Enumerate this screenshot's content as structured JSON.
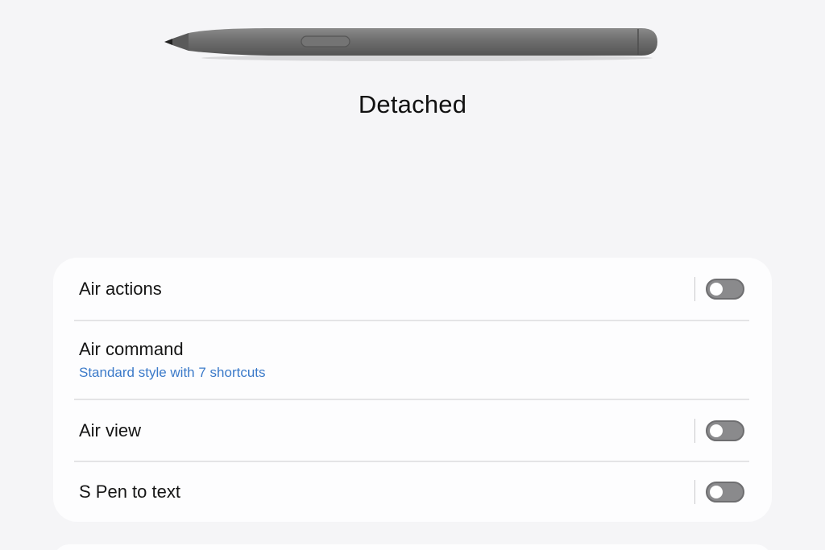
{
  "status": {
    "title": "Detached"
  },
  "settings": {
    "items": [
      {
        "label": "Air actions",
        "toggle_on": false
      },
      {
        "label": "Air command",
        "sub": "Standard style with 7 shortcuts"
      },
      {
        "label": "Air view",
        "toggle_on": false
      },
      {
        "label": "S Pen to text",
        "toggle_on": false
      }
    ]
  },
  "colors": {
    "background": "#f5f5f7",
    "card": "#fdfdfe",
    "accent": "#3b7ac9",
    "toggle_off": "#8a8a8c",
    "pen": "#6b6b6b"
  },
  "icons": {
    "pen": "s-pen-icon"
  }
}
